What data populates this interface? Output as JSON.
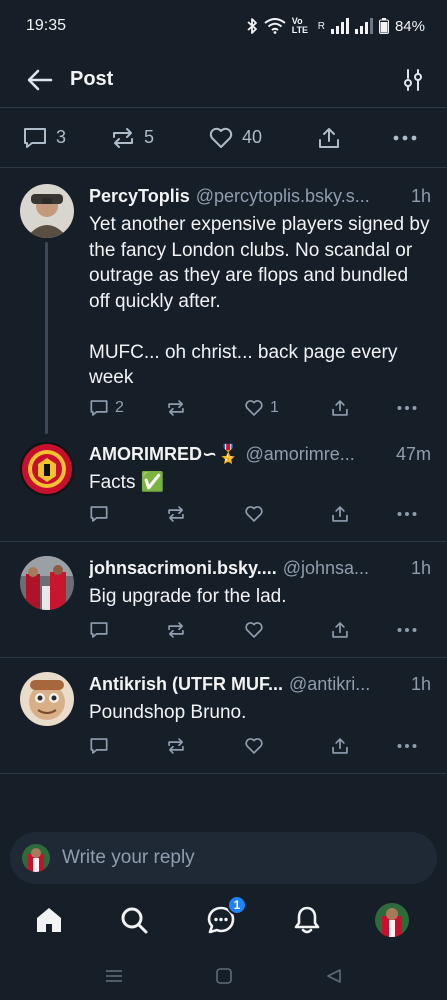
{
  "status_bar": {
    "time": "19:35",
    "battery": "84%",
    "network_label": "Vo LTE",
    "roaming": "R"
  },
  "header": {
    "title": "Post",
    "back_icon": "arrow-left-icon",
    "filter_icon": "sliders-icon"
  },
  "stats": {
    "replies": "3",
    "reposts": "5",
    "likes": "40"
  },
  "posts": [
    {
      "author": "PercyToplis",
      "handle": "@percytoplis.bsky.s...",
      "time": "1h",
      "text": "Yet another expensive players signed by the fancy London clubs. No scandal or outrage as they are flops and bundled off quickly after.\n\nMUFC... oh christ... back page every week",
      "replies": "2",
      "reposts": "",
      "likes": "1"
    },
    {
      "author": "AMORIMRED∽🎖️",
      "handle": "@amorimre...",
      "time": "47m",
      "text": "Facts ✅",
      "replies": "",
      "reposts": "",
      "likes": ""
    },
    {
      "author": "johnsacrimoni.bsky....",
      "handle": "@johnsa...",
      "time": "1h",
      "text": "Big upgrade for the lad.",
      "replies": "",
      "reposts": "",
      "likes": ""
    },
    {
      "author": "Antikrish (UTFR MUF...",
      "handle": "@antikri...",
      "time": "1h",
      "text": "Poundshop Bruno.",
      "replies": "",
      "reposts": "",
      "likes": ""
    }
  ],
  "reply_box": {
    "placeholder": "Write your reply"
  },
  "bottom_nav": {
    "items": [
      "home-icon",
      "search-icon",
      "chat-icon",
      "bell-icon",
      "profile-avatar"
    ],
    "chat_badge": "1"
  },
  "colors": {
    "background": "#161e27",
    "divider": "#2c3846",
    "muted_text": "#8f9daf",
    "accent": "#1e83f7"
  }
}
